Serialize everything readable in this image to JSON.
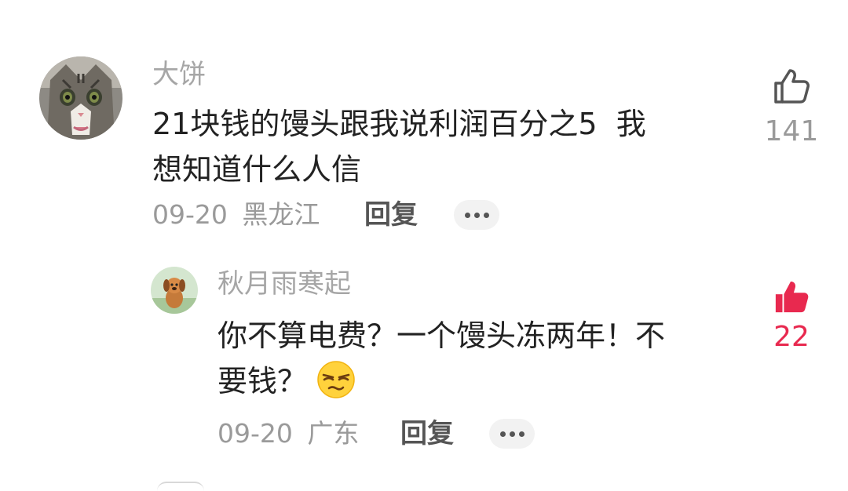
{
  "comments": [
    {
      "username": "大饼",
      "text_line1": "21块钱的馒头跟我说利润百分之5  我",
      "text_line2": "想知道什么人信",
      "date": "09-20",
      "location": "黑龙江",
      "reply_label": "回复",
      "like_count": "141",
      "liked": false
    },
    {
      "username": "秋月雨寒起",
      "text_line1": "你不算电费？一个馒头冻两年！不",
      "text_line2": "要钱？",
      "emoji": "smirk-face",
      "date": "09-20",
      "location": "广东",
      "reply_label": "回复",
      "like_count": "22",
      "liked": true
    }
  ],
  "colors": {
    "liked": "#e8294f",
    "unliked": "#9a9a9a",
    "username": "#a6a6a6",
    "text": "#222222"
  }
}
